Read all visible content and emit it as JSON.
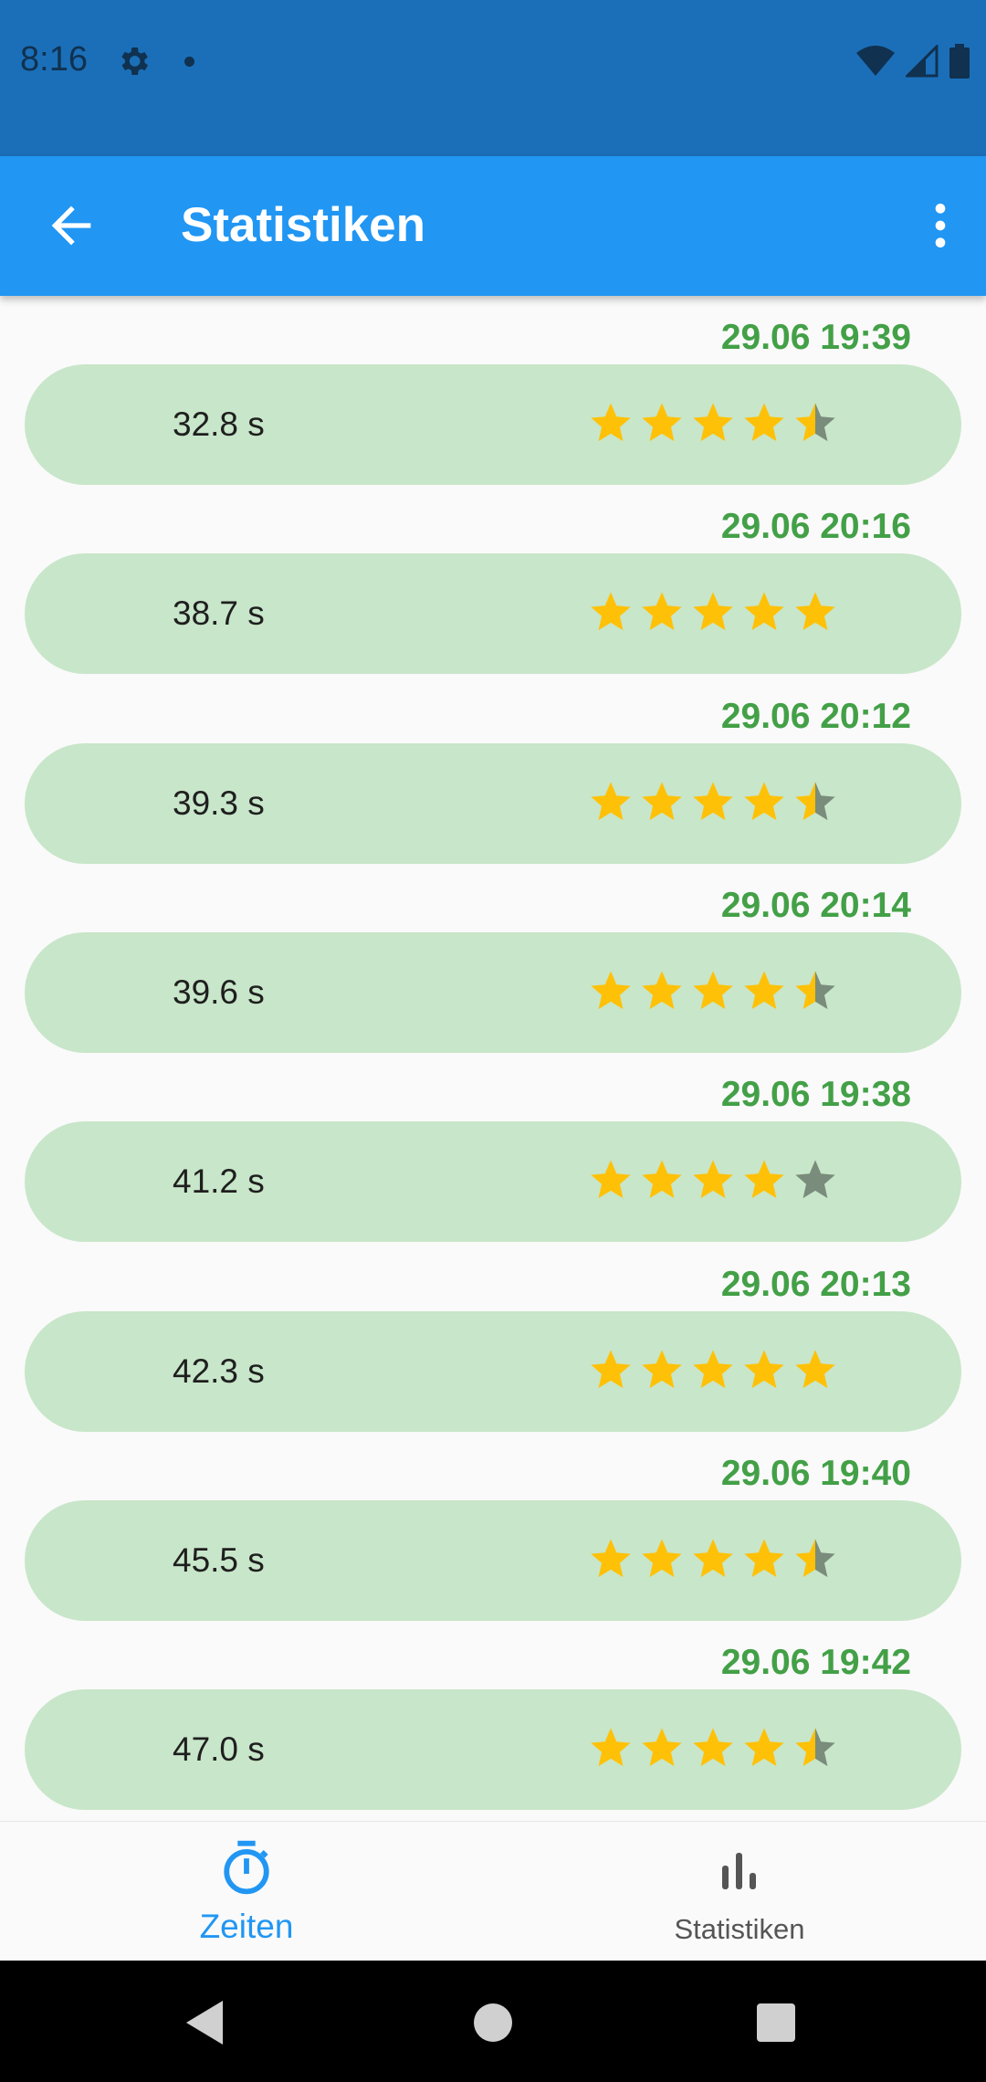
{
  "status_bar": {
    "time": "8:16"
  },
  "app_bar": {
    "title": "Statistiken"
  },
  "colors": {
    "primary": "#2196f3",
    "status_bar": "#1b6fb8",
    "pill": "#c8e6c9",
    "date": "#43a047",
    "star": "#ffc107",
    "star_empty": "#7a8c7c"
  },
  "entries": [
    {
      "date": "29.06 19:39",
      "time": "32.8 s",
      "rating": 4.5
    },
    {
      "date": "29.06 20:16",
      "time": "38.7 s",
      "rating": 5
    },
    {
      "date": "29.06 20:12",
      "time": "39.3 s",
      "rating": 4.5
    },
    {
      "date": "29.06 20:14",
      "time": "39.6 s",
      "rating": 4.5
    },
    {
      "date": "29.06 19:38",
      "time": "41.2 s",
      "rating": 4
    },
    {
      "date": "29.06 20:13",
      "time": "42.3 s",
      "rating": 5
    },
    {
      "date": "29.06 19:40",
      "time": "45.5 s",
      "rating": 4.5
    },
    {
      "date": "29.06 19:42",
      "time": "47.0 s",
      "rating": 4.5
    }
  ],
  "bottom_nav": {
    "items": [
      {
        "label": "Zeiten",
        "icon": "stopwatch-icon",
        "active": true
      },
      {
        "label": "Statistiken",
        "icon": "bar-chart-icon",
        "active": false
      }
    ]
  }
}
